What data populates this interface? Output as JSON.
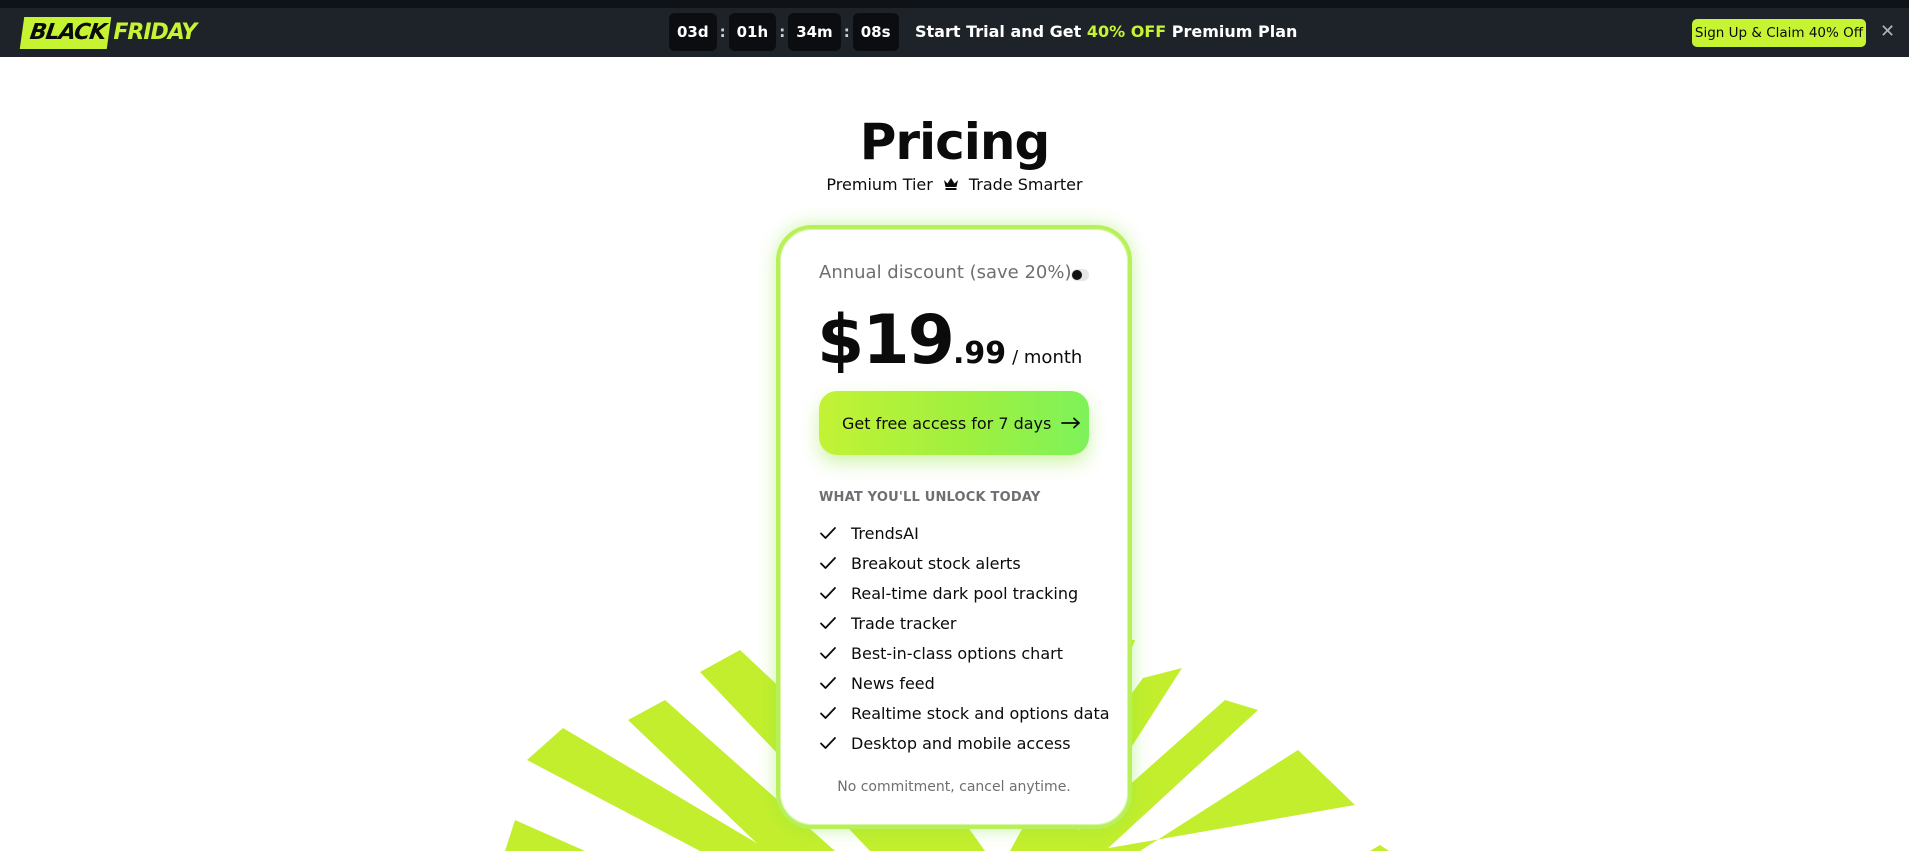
{
  "promo": {
    "logo_black": "BLACK",
    "logo_friday": "FRIDAY",
    "countdown": {
      "days": "03d",
      "hours": "01h",
      "minutes": "34m",
      "seconds": "08s",
      "separator": ":"
    },
    "text_before": "Start Trial and Get ",
    "text_highlight": "40% OFF",
    "text_after": " Premium Plan",
    "claim_button": "Sign Up & Claim 40% Off",
    "close_label": "✕"
  },
  "header": {
    "title": "Pricing",
    "subtitle_left": "Premium Tier",
    "subtitle_right": "Trade Smarter"
  },
  "card": {
    "annual_label": "Annual discount (save 20%)",
    "annual_toggle_on": false,
    "price_dollars": "$19",
    "price_cents": ".99",
    "price_period": "/ month",
    "cta_label": "Get free access for 7 days",
    "unlock_heading": "WHAT YOU'LL UNLOCK TODAY",
    "features": [
      "TrendsAI",
      "Breakout stock alerts",
      "Real-time dark pool tracking",
      "Trade tracker",
      "Best-in-class options chart",
      "News feed",
      "Realtime stock and options data",
      "Desktop and mobile access"
    ],
    "footer_note": "No commitment, cancel anytime."
  },
  "colors": {
    "accent": "#c6f432",
    "promo_bg": "#1e2329",
    "card_border": "#b8f05a",
    "burst": "#c3ee2e"
  },
  "icons": {
    "crown": "crown-icon",
    "arrow": "arrow-right-icon",
    "check": "check-icon",
    "close": "close-icon"
  }
}
